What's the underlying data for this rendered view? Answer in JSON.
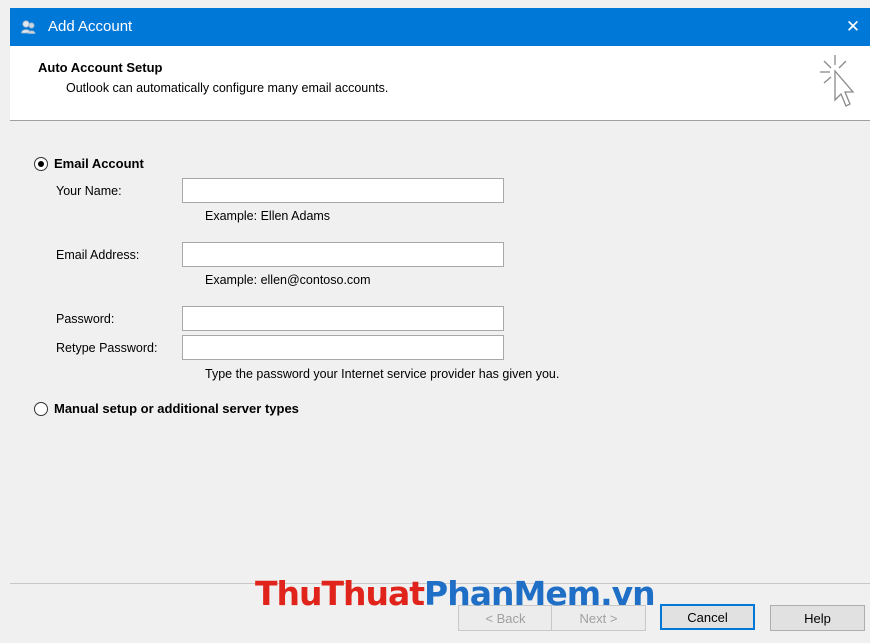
{
  "window": {
    "title": "Add Account",
    "close_glyph": "✕",
    "accent": "#0078d7"
  },
  "header": {
    "title": "Auto Account Setup",
    "subtitle": "Outlook can automatically configure many email accounts."
  },
  "options": {
    "email_account": {
      "label": "Email Account",
      "selected": true
    },
    "manual_setup": {
      "label": "Manual setup or additional server types",
      "selected": false
    }
  },
  "fields": {
    "your_name": {
      "label": "Your Name:",
      "value": "",
      "hint": "Example: Ellen Adams"
    },
    "email_address": {
      "label": "Email Address:",
      "value": "",
      "hint": "Example: ellen@contoso.com"
    },
    "password": {
      "label": "Password:",
      "value": ""
    },
    "retype_password": {
      "label": "Retype Password:",
      "value": "",
      "hint": "Type the password your Internet service provider has given you."
    }
  },
  "buttons": {
    "back": "< Back",
    "next": "Next >",
    "cancel": "Cancel",
    "help": "Help"
  },
  "watermark": {
    "part1": "ThuThuat",
    "part2": "PhanMem.vn"
  }
}
